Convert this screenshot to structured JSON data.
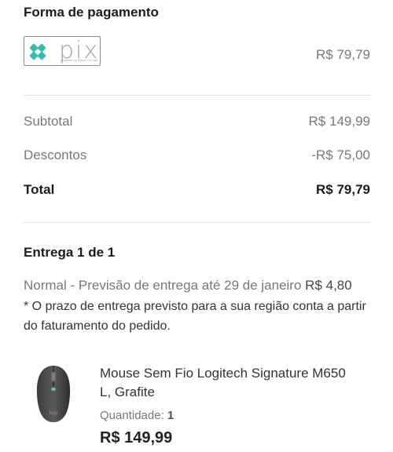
{
  "payment": {
    "title": "Forma de pagamento",
    "logo": {
      "icon": "pix-icon",
      "word": "pix",
      "subtitle": "powered by Banco Central"
    },
    "amount": "R$ 79,79"
  },
  "summary": {
    "subtotal_label": "Subtotal",
    "subtotal_value": "R$ 149,99",
    "discount_label": "Descontos",
    "discount_value": "-R$ 75,00",
    "total_label": "Total",
    "total_value": "R$ 79,79"
  },
  "delivery": {
    "title": "Entrega 1 de 1",
    "method": "Normal - Previsão de entrega até 29 de janeiro",
    "price": "R$ 4,80",
    "note": "* O prazo de entrega previsto para a sua região conta a partir do faturamento do pedido."
  },
  "product": {
    "image": "mouse-image",
    "name": "Mouse Sem Fio Logitech Signature M650 L, Grafite",
    "quantity_label": "Quantidade:",
    "quantity_value": "1",
    "price": "R$ 149,99"
  },
  "colors": {
    "pix_teal": "#32bcad",
    "muted_text": "#777777",
    "divider": "#e2e2e2"
  }
}
